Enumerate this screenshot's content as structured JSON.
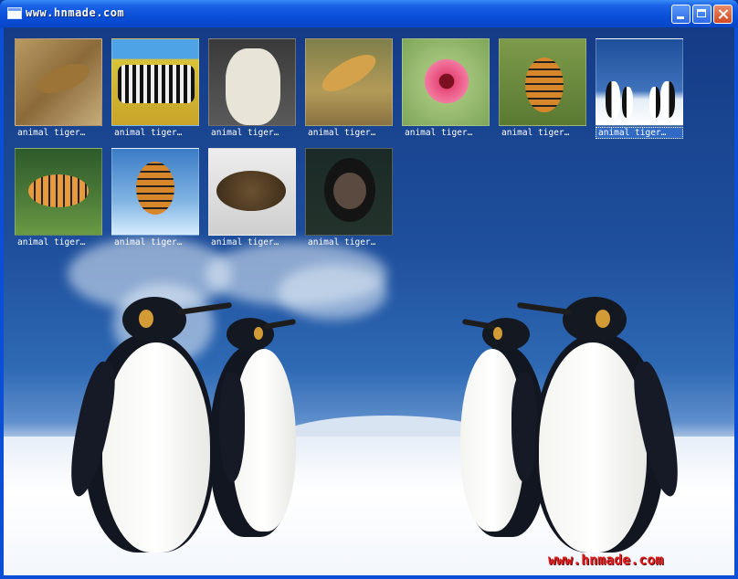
{
  "window": {
    "title": "www.hnmade.com",
    "icon": "window-icon",
    "buttons": {
      "minimize": "minimize-icon",
      "maximize": "maximize-icon",
      "close": "close-icon"
    }
  },
  "thumbnails": [
    {
      "caption": "animal tiger…",
      "subject": "leopard-in-grass"
    },
    {
      "caption": "animal tiger…",
      "subject": "zebras"
    },
    {
      "caption": "animal tiger…",
      "subject": "polar-bear"
    },
    {
      "caption": "animal tiger…",
      "subject": "leaping-cheetah"
    },
    {
      "caption": "animal tiger…",
      "subject": "pink-flower"
    },
    {
      "caption": "animal tiger…",
      "subject": "tiger-in-grass"
    },
    {
      "caption": "animal tiger…",
      "subject": "penguins",
      "selected": true
    },
    {
      "caption": "animal tiger…",
      "subject": "tiger-on-rocks"
    },
    {
      "caption": "animal tiger…",
      "subject": "tiger-in-water"
    },
    {
      "caption": "animal tiger…",
      "subject": "tortoise"
    },
    {
      "caption": "animal tiger…",
      "subject": "chimpanzee"
    }
  ],
  "watermark": "www.hnmade.com",
  "colors": {
    "titlebar": "#0a4fd8",
    "selection": "#316ac5",
    "watermark": "#e02020"
  }
}
